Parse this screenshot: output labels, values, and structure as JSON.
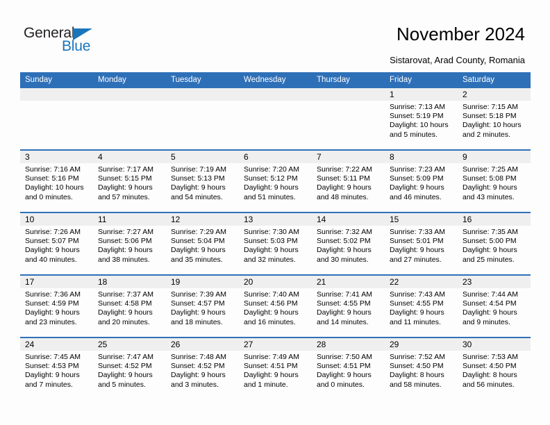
{
  "brand": {
    "name_part1": "General",
    "name_part2": "Blue",
    "accent_color": "#1b75bb"
  },
  "header": {
    "title": "November 2024",
    "subtitle": "Sistarovat, Arad County, Romania"
  },
  "theme": {
    "header_blue": "#2e70b8",
    "day_band_gray": "#efefef",
    "page_background": "#fdfdfd"
  },
  "calendar": {
    "weekday_headers": [
      "Sunday",
      "Monday",
      "Tuesday",
      "Wednesday",
      "Thursday",
      "Friday",
      "Saturday"
    ],
    "labels": {
      "sunrise": "Sunrise:",
      "sunset": "Sunset:",
      "daylight": "Daylight:"
    },
    "weeks": [
      [
        {
          "day": "",
          "empty": true
        },
        {
          "day": "",
          "empty": true
        },
        {
          "day": "",
          "empty": true
        },
        {
          "day": "",
          "empty": true
        },
        {
          "day": "",
          "empty": true
        },
        {
          "day": "1",
          "sunrise": "Sunrise: 7:13 AM",
          "sunset": "Sunset: 5:19 PM",
          "daylight_line1": "Daylight: 10 hours",
          "daylight_line2": "and 5 minutes."
        },
        {
          "day": "2",
          "sunrise": "Sunrise: 7:15 AM",
          "sunset": "Sunset: 5:18 PM",
          "daylight_line1": "Daylight: 10 hours",
          "daylight_line2": "and 2 minutes."
        }
      ],
      [
        {
          "day": "3",
          "sunrise": "Sunrise: 7:16 AM",
          "sunset": "Sunset: 5:16 PM",
          "daylight_line1": "Daylight: 10 hours",
          "daylight_line2": "and 0 minutes."
        },
        {
          "day": "4",
          "sunrise": "Sunrise: 7:17 AM",
          "sunset": "Sunset: 5:15 PM",
          "daylight_line1": "Daylight: 9 hours",
          "daylight_line2": "and 57 minutes."
        },
        {
          "day": "5",
          "sunrise": "Sunrise: 7:19 AM",
          "sunset": "Sunset: 5:13 PM",
          "daylight_line1": "Daylight: 9 hours",
          "daylight_line2": "and 54 minutes."
        },
        {
          "day": "6",
          "sunrise": "Sunrise: 7:20 AM",
          "sunset": "Sunset: 5:12 PM",
          "daylight_line1": "Daylight: 9 hours",
          "daylight_line2": "and 51 minutes."
        },
        {
          "day": "7",
          "sunrise": "Sunrise: 7:22 AM",
          "sunset": "Sunset: 5:11 PM",
          "daylight_line1": "Daylight: 9 hours",
          "daylight_line2": "and 48 minutes."
        },
        {
          "day": "8",
          "sunrise": "Sunrise: 7:23 AM",
          "sunset": "Sunset: 5:09 PM",
          "daylight_line1": "Daylight: 9 hours",
          "daylight_line2": "and 46 minutes."
        },
        {
          "day": "9",
          "sunrise": "Sunrise: 7:25 AM",
          "sunset": "Sunset: 5:08 PM",
          "daylight_line1": "Daylight: 9 hours",
          "daylight_line2": "and 43 minutes."
        }
      ],
      [
        {
          "day": "10",
          "sunrise": "Sunrise: 7:26 AM",
          "sunset": "Sunset: 5:07 PM",
          "daylight_line1": "Daylight: 9 hours",
          "daylight_line2": "and 40 minutes."
        },
        {
          "day": "11",
          "sunrise": "Sunrise: 7:27 AM",
          "sunset": "Sunset: 5:06 PM",
          "daylight_line1": "Daylight: 9 hours",
          "daylight_line2": "and 38 minutes."
        },
        {
          "day": "12",
          "sunrise": "Sunrise: 7:29 AM",
          "sunset": "Sunset: 5:04 PM",
          "daylight_line1": "Daylight: 9 hours",
          "daylight_line2": "and 35 minutes."
        },
        {
          "day": "13",
          "sunrise": "Sunrise: 7:30 AM",
          "sunset": "Sunset: 5:03 PM",
          "daylight_line1": "Daylight: 9 hours",
          "daylight_line2": "and 32 minutes."
        },
        {
          "day": "14",
          "sunrise": "Sunrise: 7:32 AM",
          "sunset": "Sunset: 5:02 PM",
          "daylight_line1": "Daylight: 9 hours",
          "daylight_line2": "and 30 minutes."
        },
        {
          "day": "15",
          "sunrise": "Sunrise: 7:33 AM",
          "sunset": "Sunset: 5:01 PM",
          "daylight_line1": "Daylight: 9 hours",
          "daylight_line2": "and 27 minutes."
        },
        {
          "day": "16",
          "sunrise": "Sunrise: 7:35 AM",
          "sunset": "Sunset: 5:00 PM",
          "daylight_line1": "Daylight: 9 hours",
          "daylight_line2": "and 25 minutes."
        }
      ],
      [
        {
          "day": "17",
          "sunrise": "Sunrise: 7:36 AM",
          "sunset": "Sunset: 4:59 PM",
          "daylight_line1": "Daylight: 9 hours",
          "daylight_line2": "and 23 minutes."
        },
        {
          "day": "18",
          "sunrise": "Sunrise: 7:37 AM",
          "sunset": "Sunset: 4:58 PM",
          "daylight_line1": "Daylight: 9 hours",
          "daylight_line2": "and 20 minutes."
        },
        {
          "day": "19",
          "sunrise": "Sunrise: 7:39 AM",
          "sunset": "Sunset: 4:57 PM",
          "daylight_line1": "Daylight: 9 hours",
          "daylight_line2": "and 18 minutes."
        },
        {
          "day": "20",
          "sunrise": "Sunrise: 7:40 AM",
          "sunset": "Sunset: 4:56 PM",
          "daylight_line1": "Daylight: 9 hours",
          "daylight_line2": "and 16 minutes."
        },
        {
          "day": "21",
          "sunrise": "Sunrise: 7:41 AM",
          "sunset": "Sunset: 4:55 PM",
          "daylight_line1": "Daylight: 9 hours",
          "daylight_line2": "and 14 minutes."
        },
        {
          "day": "22",
          "sunrise": "Sunrise: 7:43 AM",
          "sunset": "Sunset: 4:55 PM",
          "daylight_line1": "Daylight: 9 hours",
          "daylight_line2": "and 11 minutes."
        },
        {
          "day": "23",
          "sunrise": "Sunrise: 7:44 AM",
          "sunset": "Sunset: 4:54 PM",
          "daylight_line1": "Daylight: 9 hours",
          "daylight_line2": "and 9 minutes."
        }
      ],
      [
        {
          "day": "24",
          "sunrise": "Sunrise: 7:45 AM",
          "sunset": "Sunset: 4:53 PM",
          "daylight_line1": "Daylight: 9 hours",
          "daylight_line2": "and 7 minutes."
        },
        {
          "day": "25",
          "sunrise": "Sunrise: 7:47 AM",
          "sunset": "Sunset: 4:52 PM",
          "daylight_line1": "Daylight: 9 hours",
          "daylight_line2": "and 5 minutes."
        },
        {
          "day": "26",
          "sunrise": "Sunrise: 7:48 AM",
          "sunset": "Sunset: 4:52 PM",
          "daylight_line1": "Daylight: 9 hours",
          "daylight_line2": "and 3 minutes."
        },
        {
          "day": "27",
          "sunrise": "Sunrise: 7:49 AM",
          "sunset": "Sunset: 4:51 PM",
          "daylight_line1": "Daylight: 9 hours",
          "daylight_line2": "and 1 minute."
        },
        {
          "day": "28",
          "sunrise": "Sunrise: 7:50 AM",
          "sunset": "Sunset: 4:51 PM",
          "daylight_line1": "Daylight: 9 hours",
          "daylight_line2": "and 0 minutes."
        },
        {
          "day": "29",
          "sunrise": "Sunrise: 7:52 AM",
          "sunset": "Sunset: 4:50 PM",
          "daylight_line1": "Daylight: 8 hours",
          "daylight_line2": "and 58 minutes."
        },
        {
          "day": "30",
          "sunrise": "Sunrise: 7:53 AM",
          "sunset": "Sunset: 4:50 PM",
          "daylight_line1": "Daylight: 8 hours",
          "daylight_line2": "and 56 minutes."
        }
      ]
    ]
  }
}
